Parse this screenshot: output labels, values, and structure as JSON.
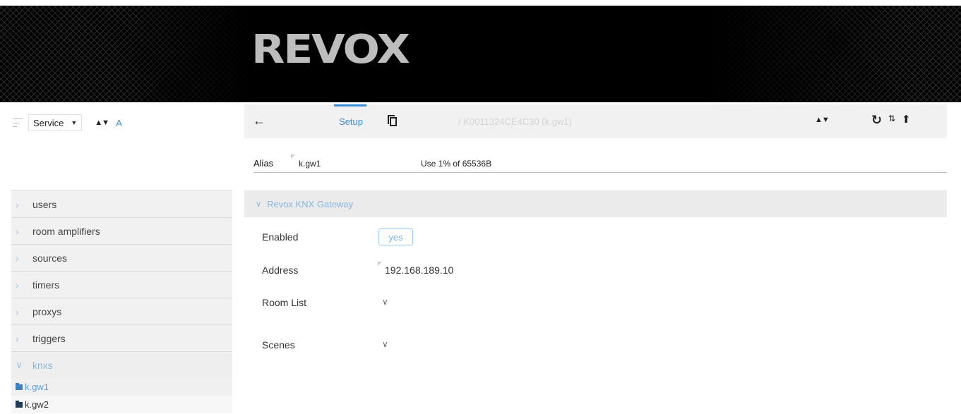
{
  "header": {
    "logo": "REVOX"
  },
  "sidebar": {
    "select_value": "Service",
    "sort_icon": "▲▼",
    "a_label": "A",
    "items": [
      {
        "label": "users"
      },
      {
        "label": "room amplifiers"
      },
      {
        "label": "sources"
      },
      {
        "label": "timers"
      },
      {
        "label": "proxys"
      },
      {
        "label": "triggers"
      },
      {
        "label": "knxs"
      }
    ],
    "subitems": [
      {
        "label": "k.gw1"
      },
      {
        "label": "k.gw2"
      }
    ]
  },
  "toolbar": {
    "back_icon": "←",
    "tab_setup": "Setup",
    "path": "/ K0011324CE4C30 (k.gw1)",
    "sort_icon": "▲▼",
    "reload_icon": "C",
    "swap_icon": "⇅",
    "upload_icon": "⇧"
  },
  "alias": {
    "label": "Alias",
    "value": "k.gw1",
    "usage": "Use 1% of 65536B"
  },
  "section": {
    "title": "Revox KNX Gateway",
    "fields": {
      "enabled_label": "Enabled",
      "enabled_value": "yes",
      "address_label": "Address",
      "address_value": "192.168.189.10",
      "room_list_label": "Room List",
      "scenes_label": "Scenes"
    }
  },
  "colors": {
    "accent": "#3a8fd8",
    "accent_light": "#8ab6de",
    "banner": "#000000"
  }
}
